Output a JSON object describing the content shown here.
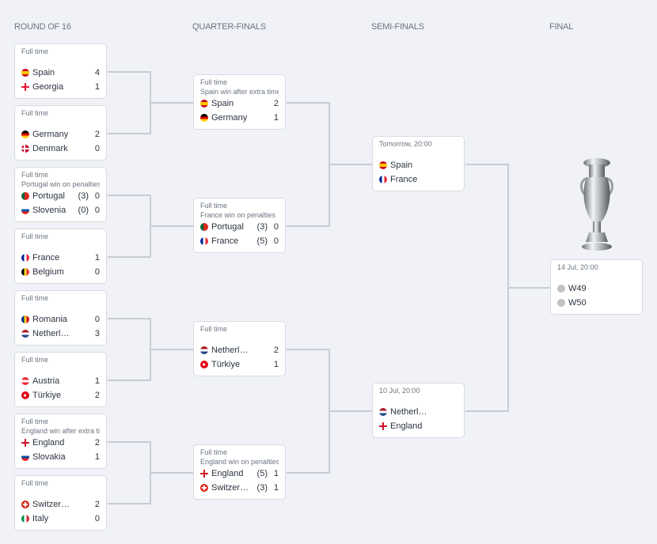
{
  "rounds": {
    "r16": "ROUND OF 16",
    "qf": "QUARTER-FINALS",
    "sf": "SEMI-FINALS",
    "final": "FINAL"
  },
  "colors": {
    "background": "#f0f2f7",
    "card": "#ffffff",
    "connector": "#c9ccd3",
    "muted_text": "#6b7580"
  },
  "r16": [
    {
      "status": "Full time",
      "note": "",
      "home": {
        "name": "Spain",
        "flag": "spain-flag",
        "score": "4",
        "pens": ""
      },
      "away": {
        "name": "Georgia",
        "flag": "georgia-flag",
        "score": "1",
        "pens": ""
      }
    },
    {
      "status": "Full time",
      "note": "",
      "home": {
        "name": "Germany",
        "flag": "germany-flag",
        "score": "2",
        "pens": ""
      },
      "away": {
        "name": "Denmark",
        "flag": "denmark-flag",
        "score": "0",
        "pens": ""
      }
    },
    {
      "status": "Full time",
      "note": "Portugal win on penalties",
      "home": {
        "name": "Portugal",
        "flag": "portugal-flag",
        "score": "0",
        "pens": "(3)"
      },
      "away": {
        "name": "Slovenia",
        "flag": "slovenia-flag",
        "score": "0",
        "pens": "(0)"
      }
    },
    {
      "status": "Full time",
      "note": "",
      "home": {
        "name": "France",
        "flag": "france-flag",
        "score": "1",
        "pens": ""
      },
      "away": {
        "name": "Belgium",
        "flag": "belgium-flag",
        "score": "0",
        "pens": ""
      }
    },
    {
      "status": "Full time",
      "note": "",
      "home": {
        "name": "Romania",
        "flag": "romania-flag",
        "score": "0",
        "pens": ""
      },
      "away": {
        "name": "Netherlands",
        "flag": "netherlands-flag",
        "score": "3",
        "pens": ""
      }
    },
    {
      "status": "Full time",
      "note": "",
      "home": {
        "name": "Austria",
        "flag": "austria-flag",
        "score": "1",
        "pens": ""
      },
      "away": {
        "name": "Türkiye",
        "flag": "turkiye-flag",
        "score": "2",
        "pens": ""
      }
    },
    {
      "status": "Full time",
      "note": "England win after extra time",
      "home": {
        "name": "England",
        "flag": "england-flag",
        "score": "2",
        "pens": ""
      },
      "away": {
        "name": "Slovakia",
        "flag": "slovakia-flag",
        "score": "1",
        "pens": ""
      }
    },
    {
      "status": "Full time",
      "note": "",
      "home": {
        "name": "Switzerland",
        "flag": "switzerland-flag",
        "score": "2",
        "pens": ""
      },
      "away": {
        "name": "Italy",
        "flag": "italy-flag",
        "score": "0",
        "pens": ""
      }
    }
  ],
  "qf": [
    {
      "status": "Full time",
      "note": "Spain win after extra time",
      "home": {
        "name": "Spain",
        "flag": "spain-flag",
        "score": "2",
        "pens": ""
      },
      "away": {
        "name": "Germany",
        "flag": "germany-flag",
        "score": "1",
        "pens": ""
      }
    },
    {
      "status": "Full time",
      "note": "France win on penalties",
      "home": {
        "name": "Portugal",
        "flag": "portugal-flag",
        "score": "0",
        "pens": "(3)"
      },
      "away": {
        "name": "France",
        "flag": "france-flag",
        "score": "0",
        "pens": "(5)"
      }
    },
    {
      "status": "Full time",
      "note": "",
      "home": {
        "name": "Netherlands",
        "flag": "netherlands-flag",
        "score": "2",
        "pens": ""
      },
      "away": {
        "name": "Türkiye",
        "flag": "turkiye-flag",
        "score": "1",
        "pens": ""
      }
    },
    {
      "status": "Full time",
      "note": "England win on penalties",
      "home": {
        "name": "England",
        "flag": "england-flag",
        "score": "1",
        "pens": "(5)"
      },
      "away": {
        "name": "Switzerland",
        "flag": "switzerland-flag",
        "score": "1",
        "pens": "(3)"
      }
    }
  ],
  "sf": [
    {
      "status": "Tomorrow, 20:00",
      "note": "",
      "home": {
        "name": "Spain",
        "flag": "spain-flag",
        "score": "",
        "pens": ""
      },
      "away": {
        "name": "France",
        "flag": "france-flag",
        "score": "",
        "pens": ""
      }
    },
    {
      "status": "10 Jul, 20:00",
      "note": "",
      "home": {
        "name": "Netherlands",
        "flag": "netherlands-flag",
        "score": "",
        "pens": ""
      },
      "away": {
        "name": "England",
        "flag": "england-flag",
        "score": "",
        "pens": ""
      }
    }
  ],
  "final": [
    {
      "status": "14 Jul, 20:00",
      "note": "",
      "home": {
        "name": "W49",
        "flag": "placeholder-flag",
        "score": "",
        "pens": ""
      },
      "away": {
        "name": "W50",
        "flag": "placeholder-flag",
        "score": "",
        "pens": ""
      }
    }
  ],
  "trophy": "trophy-icon"
}
